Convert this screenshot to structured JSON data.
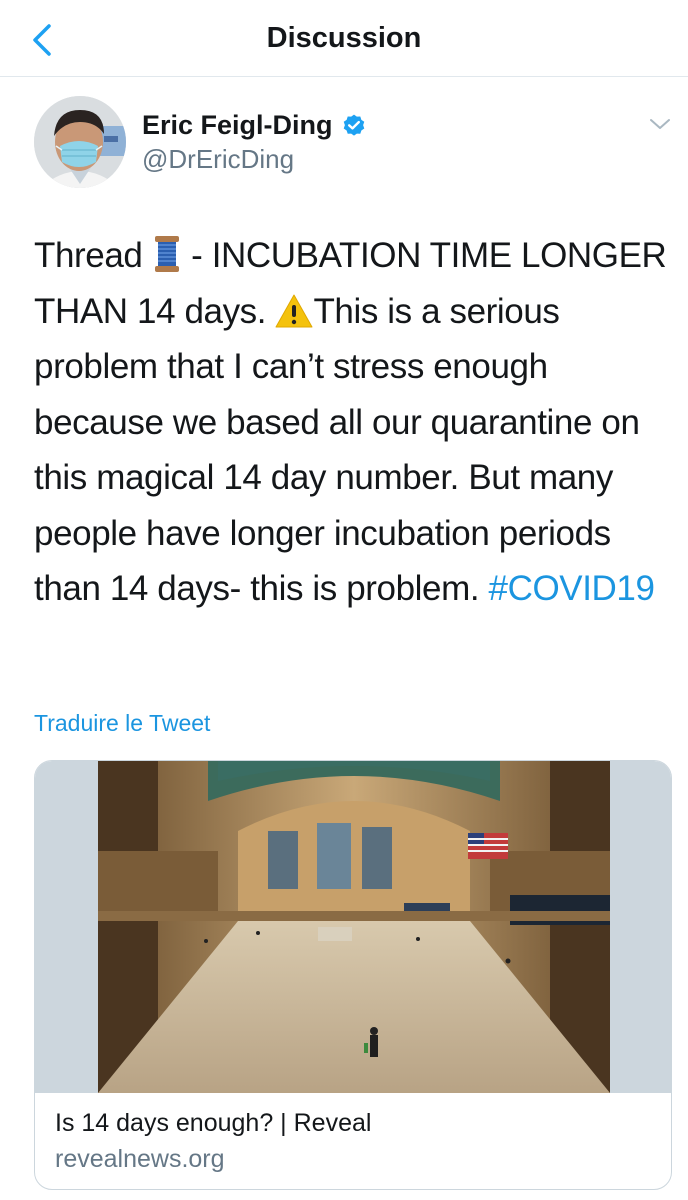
{
  "header": {
    "title": "Discussion",
    "back_icon": "chevron-left-icon"
  },
  "author": {
    "name": "Eric Feigl-Ding",
    "handle": "@DrEricDing",
    "verified": true
  },
  "tweet": {
    "part1": "Thread ",
    "part2": " - INCUBATION TIME LONGER THAN 14 days. ",
    "part3": "This is a serious problem that I can’t stress enough because we based all our quarantine on this magical 14 day number. But many people have longer incubation periods than 14 days- this is problem. ",
    "hashtag": "#COVID19",
    "emojis": [
      "spool-of-thread-emoji",
      "warning-emoji"
    ]
  },
  "translate_label": "Traduire le Tweet",
  "card": {
    "title": "Is 14 days enough? | Reveal",
    "domain": "revealnews.org"
  },
  "colors": {
    "link": "#1b95e0",
    "secondary_text": "#657786",
    "border": "#ccd6dd"
  }
}
